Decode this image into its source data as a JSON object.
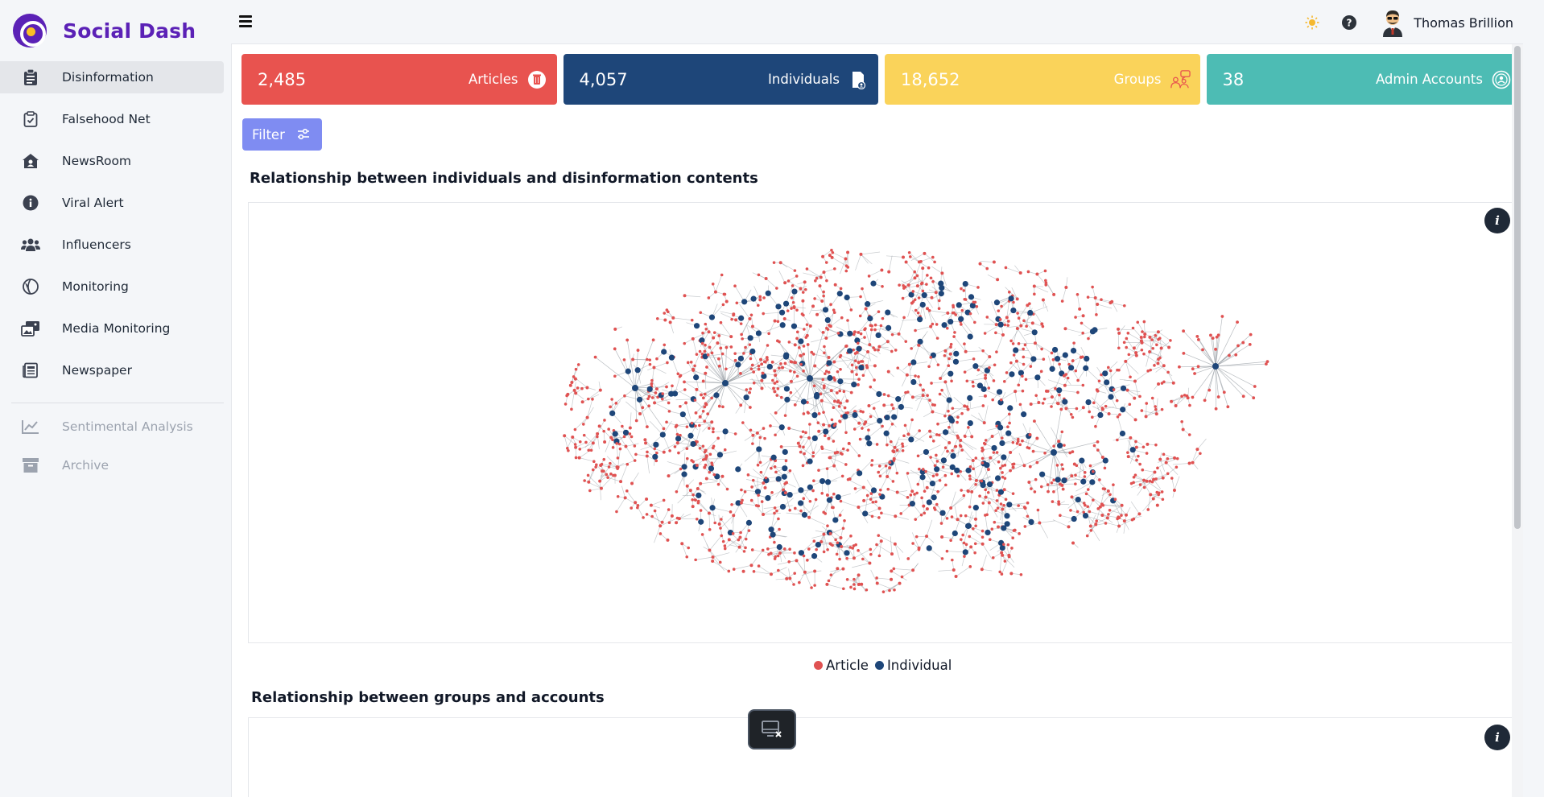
{
  "app": {
    "name": "Social Dash"
  },
  "sidebar": {
    "items": [
      {
        "label": "Disinformation",
        "icon": "clipboard-list-icon",
        "active": true
      },
      {
        "label": "Falsehood Net",
        "icon": "clipboard-check-icon"
      },
      {
        "label": "NewsRoom",
        "icon": "house-user-icon"
      },
      {
        "label": "Viral Alert",
        "icon": "info-circle-icon"
      },
      {
        "label": "Influencers",
        "icon": "users-icon"
      },
      {
        "label": "Monitoring",
        "icon": "globe-icon"
      },
      {
        "label": "Media Monitoring",
        "icon": "photo-video-icon"
      },
      {
        "label": "Newspaper",
        "icon": "newspaper-icon"
      }
    ],
    "disabled_items": [
      {
        "label": "Sentimental Analysis",
        "icon": "chart-line-icon"
      },
      {
        "label": "Archive",
        "icon": "archive-icon"
      }
    ]
  },
  "topbar": {
    "user_name": "Thomas Brillion",
    "icons": [
      "menu-icon",
      "sun-icon",
      "help-icon",
      "avatar"
    ]
  },
  "stats": [
    {
      "value": "2,485",
      "label": "Articles",
      "color": "#e8534f",
      "icon": "trash-icon"
    },
    {
      "value": "4,057",
      "label": "Individuals",
      "color": "#1e4679",
      "icon": "file-user-icon"
    },
    {
      "value": "18,652",
      "label": "Groups",
      "color": "#fad35a",
      "icon": "group-chat-icon"
    },
    {
      "value": "38",
      "label": "Admin Accounts",
      "color": "#4dbcb4",
      "icon": "admin-icon"
    }
  ],
  "filter": {
    "label": "Filter"
  },
  "sections": [
    {
      "title": "Relationship between individuals and disinformation contents"
    },
    {
      "title": "Relationship between groups and accounts"
    }
  ],
  "legend": [
    {
      "label": "Article",
      "color": "#e05252"
    },
    {
      "label": "Individual",
      "color": "#1e4679"
    }
  ],
  "colors": {
    "brand": "#5b21b6",
    "filter": "#7f8cf2",
    "article_node": "#e05252",
    "individual_node": "#1e4679",
    "edge": "#9aa0a6"
  }
}
